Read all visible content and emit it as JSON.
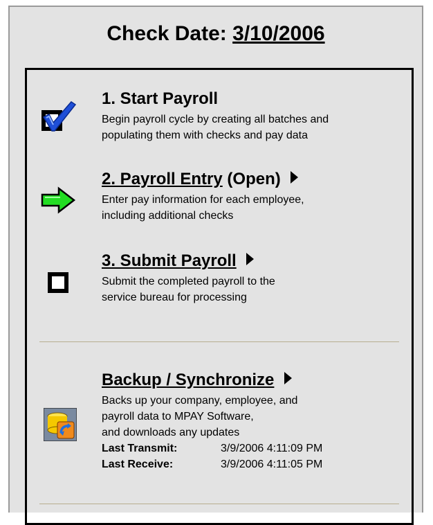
{
  "header": {
    "label": "Check Date:",
    "date": "3/10/2006"
  },
  "steps": [
    {
      "title": "1. Start Payroll",
      "desc": [
        "Begin payroll cycle by creating all batches and",
        "populating them with checks and pay data"
      ],
      "icon": "checkmark-icon"
    },
    {
      "title": "2. Payroll Entry",
      "status": "(Open)",
      "desc": [
        "Enter pay information for each employee,",
        "including additional checks"
      ],
      "icon": "green-arrow-icon"
    },
    {
      "title": "3. Submit Payroll",
      "desc": [
        "Submit the completed payroll to the",
        "service bureau for processing"
      ],
      "icon": "empty-checkbox-icon"
    }
  ],
  "backup": {
    "title": "Backup / Synchronize",
    "desc": [
      "Backs up your company, employee, and",
      "payroll data to MPAY Software,",
      "and downloads any updates"
    ],
    "last_transmit_label": "Last Transmit:",
    "last_transmit_value": "3/9/2006 4:11:09 PM",
    "last_receive_label": "Last Receive:",
    "last_receive_value": "3/9/2006 4:11:05 PM",
    "icon": "database-sync-icon"
  },
  "colors": {
    "panel_bg": "#e3e3e3",
    "divider": "#b7ad8f",
    "arrow_green": "#22dd22",
    "check_blue": "#1f4fd8"
  }
}
